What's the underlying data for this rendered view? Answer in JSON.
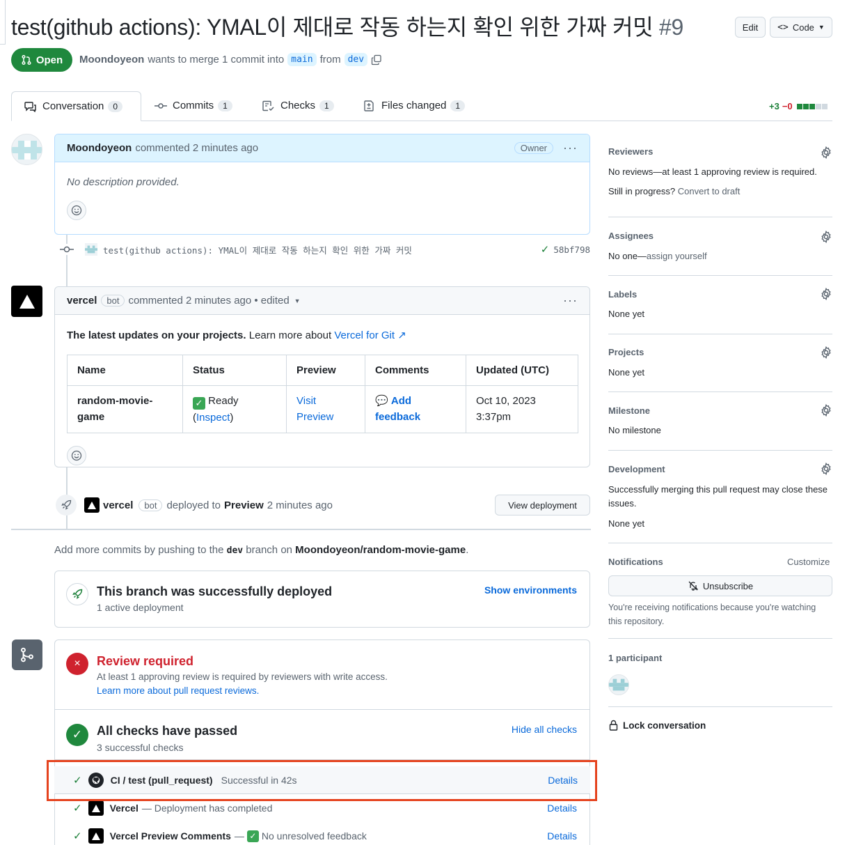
{
  "pr": {
    "title": "test(github actions): YMAL이 제대로 작동 하는지 확인 위한 가짜 커밋",
    "number": "#9",
    "edit_label": "Edit",
    "code_label": "Code",
    "state_label": "Open",
    "author": "Moondoyeon",
    "merge_text": "wants to merge 1 commit into",
    "base_branch": "main",
    "from_text": "from",
    "head_branch": "dev"
  },
  "tabs": [
    {
      "label": "Conversation",
      "count": "0"
    },
    {
      "label": "Commits",
      "count": "1"
    },
    {
      "label": "Checks",
      "count": "1"
    },
    {
      "label": "Files changed",
      "count": "1"
    }
  ],
  "diffstat": {
    "added": "+3",
    "removed": "−0"
  },
  "comment1": {
    "author": "Moondoyeon",
    "action": "commented 2 minutes ago",
    "badge": "Owner",
    "body": "No description provided."
  },
  "commit": {
    "message": "test(github actions): YMAL이 제대로 작동 하는지 확인 위한 가짜 커밋",
    "sha": "58bf798"
  },
  "comment2": {
    "author": "vercel",
    "badge": "bot",
    "action": "commented 2 minutes ago • edited",
    "intro_bold": "The latest updates on your projects.",
    "intro_rest": "Learn more about",
    "intro_link": "Vercel for Git ↗",
    "headers": [
      "Name",
      "Status",
      "Preview",
      "Comments",
      "Updated (UTC)"
    ],
    "row": {
      "name": "random-movie-game",
      "status_text": "Ready",
      "status_link": "Inspect",
      "preview": "Visit Preview",
      "comments_icon": "💬",
      "comments": "Add feedback",
      "updated": "Oct 10, 2023 3:37pm"
    }
  },
  "deploy_event": {
    "author": "vercel",
    "badge": "bot",
    "text_pre": "deployed to",
    "env": "Preview",
    "time": "2 minutes ago",
    "button": "View deployment"
  },
  "push_hint": {
    "pre": "Add more commits by pushing to the",
    "branch": "dev",
    "mid": "branch on",
    "repo": "Moondoyeon/random-movie-game",
    "end": "."
  },
  "deployed_box": {
    "title": "This branch was successfully deployed",
    "sub": "1 active deployment",
    "link": "Show environments"
  },
  "merge_box": {
    "review_title": "Review required",
    "review_sub": "At least 1 approving review is required by reviewers with write access.",
    "review_link": "Learn more about pull request reviews.",
    "checks_title": "All checks have passed",
    "checks_sub": "3 successful checks",
    "checks_link": "Hide all checks",
    "checks": [
      {
        "name": "CI / test (pull_request)",
        "desc": "Successful in 42s",
        "link": "Details"
      },
      {
        "name": "Vercel",
        "desc": "— Deployment has completed",
        "link": "Details"
      },
      {
        "name": "Vercel Preview Comments",
        "desc": "No unresolved feedback",
        "link": "Details"
      }
    ],
    "check3_sep": "—"
  },
  "sidebar": {
    "reviewers_title": "Reviewers",
    "reviewers_text": "No reviews—at least 1 approving review is required.",
    "progress_text": "Still in progress?",
    "progress_link": "Convert to draft",
    "assignees_title": "Assignees",
    "assignees_text": "No one—",
    "assignees_link": "assign yourself",
    "labels_title": "Labels",
    "labels_text": "None yet",
    "projects_title": "Projects",
    "projects_text": "None yet",
    "milestone_title": "Milestone",
    "milestone_text": "No milestone",
    "development_title": "Development",
    "development_text": "Successfully merging this pull request may close these issues.",
    "development_none": "None yet",
    "notifications_title": "Notifications",
    "customize": "Customize",
    "unsubscribe": "Unsubscribe",
    "notif_reason": "You're receiving notifications because you're watching this repository.",
    "participants": "1 participant",
    "lock": "Lock conversation"
  },
  "colors": {
    "open_green": "#1f883d",
    "highlight_red": "#e5431e",
    "danger": "#cf222e",
    "link": "#0969da"
  }
}
